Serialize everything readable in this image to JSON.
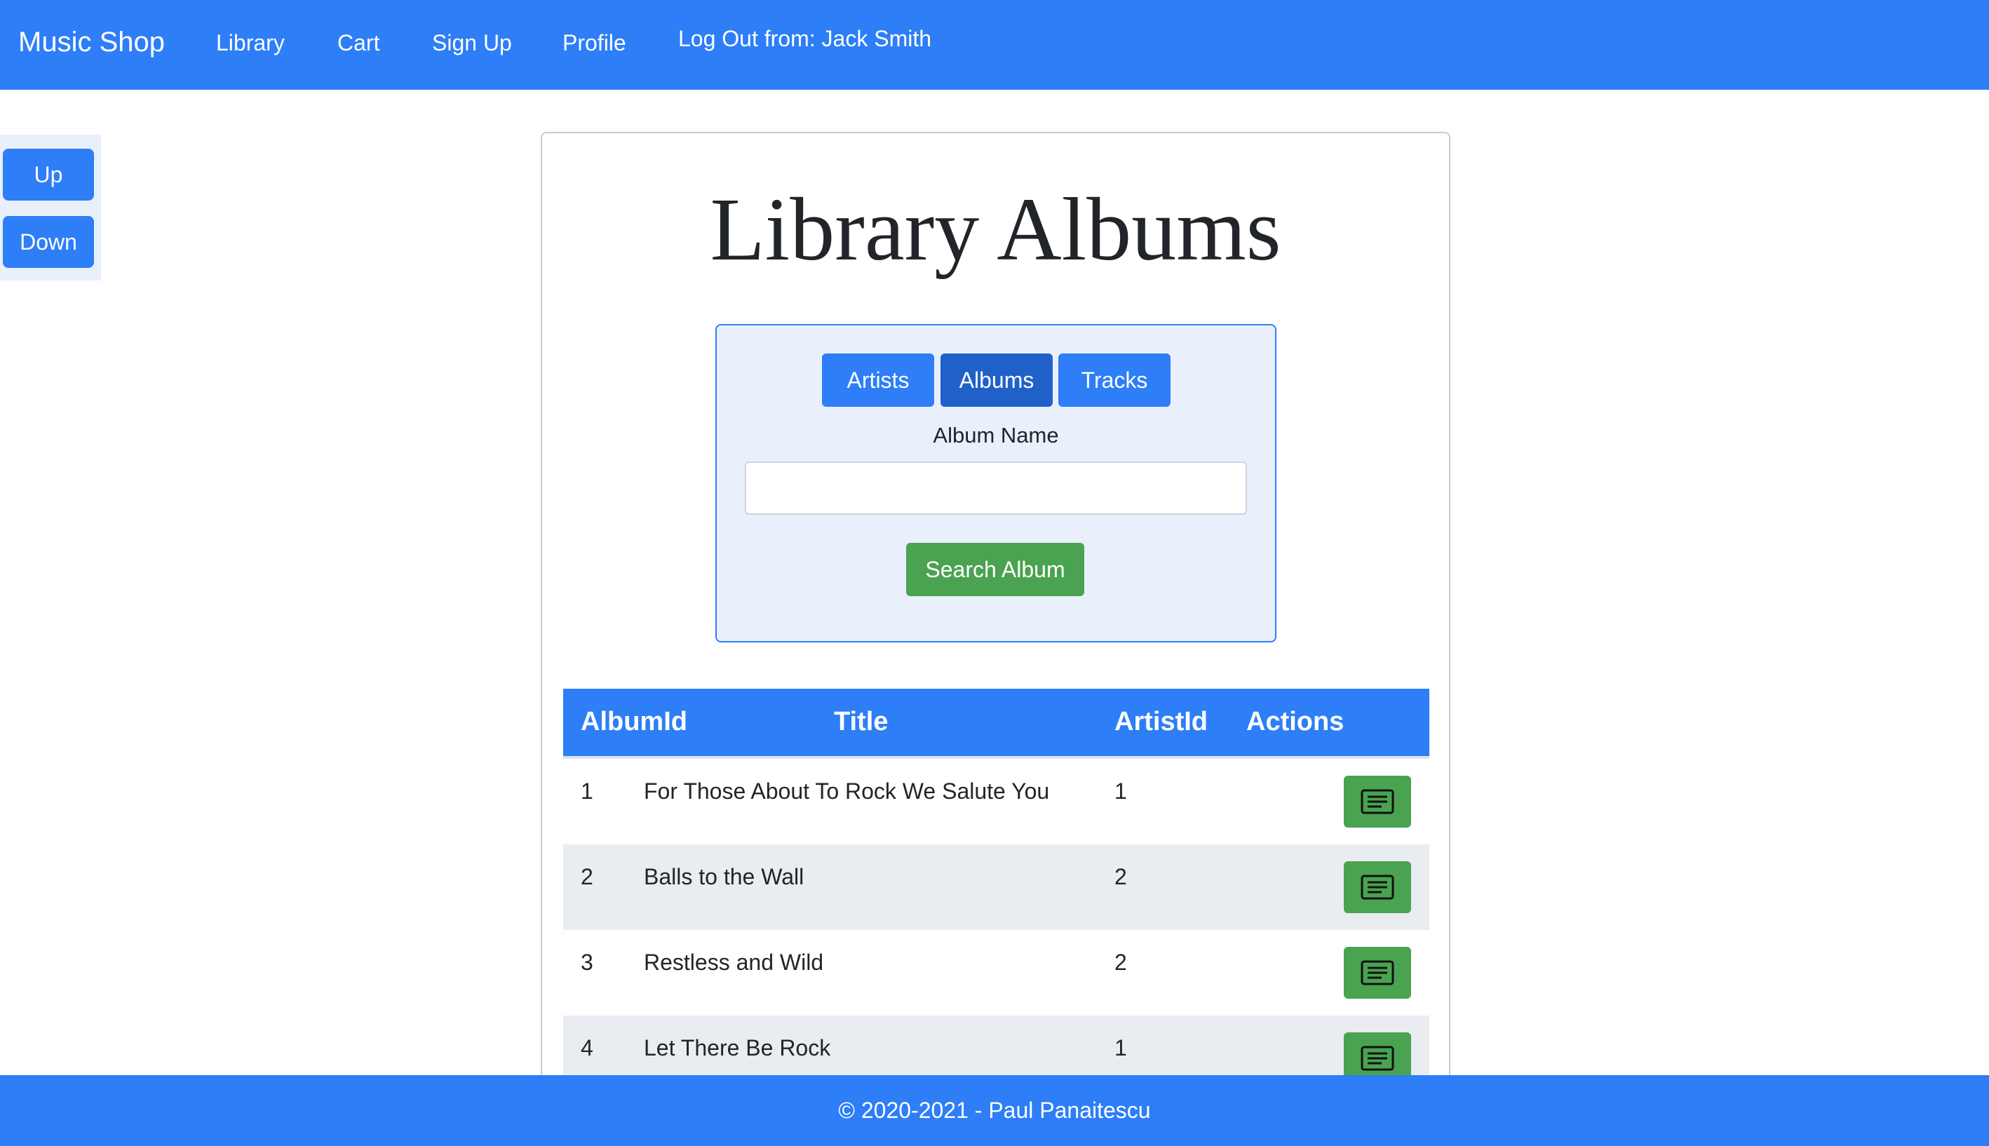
{
  "navbar": {
    "brand": "Music Shop",
    "links": [
      {
        "label": "Library"
      },
      {
        "label": "Cart"
      },
      {
        "label": "Sign Up"
      },
      {
        "label": "Profile"
      },
      {
        "label": "Log Out from: Jack Smith"
      }
    ]
  },
  "scroll_controls": {
    "up_label": "Up",
    "down_label": "Down"
  },
  "main": {
    "title": "Library Albums",
    "search": {
      "tabs": [
        {
          "label": "Artists",
          "active": false
        },
        {
          "label": "Albums",
          "active": true
        },
        {
          "label": "Tracks",
          "active": false
        }
      ],
      "field_label": "Album Name",
      "field_value": "",
      "button_label": "Search Album"
    },
    "table": {
      "headers": [
        "AlbumId",
        "Title",
        "ArtistId",
        "Actions"
      ],
      "rows": [
        {
          "album_id": "1",
          "title": "For Those About To Rock We Salute You",
          "artist_id": "1",
          "action_icon": "details-icon"
        },
        {
          "album_id": "2",
          "title": "Balls to the Wall",
          "artist_id": "2",
          "action_icon": "details-icon"
        },
        {
          "album_id": "3",
          "title": "Restless and Wild",
          "artist_id": "2",
          "action_icon": "details-icon"
        },
        {
          "album_id": "4",
          "title": "Let There Be Rock",
          "artist_id": "1",
          "action_icon": "details-icon"
        }
      ]
    }
  },
  "footer": {
    "text": "© 2020-2021 - Paul Panaitescu"
  },
  "colors": {
    "primary": "#2d7ef7",
    "primary_active": "#1f61c9",
    "success": "#4aa350",
    "panel_bg": "#e9f0fc",
    "stripe_bg": "#e9ecf0"
  }
}
